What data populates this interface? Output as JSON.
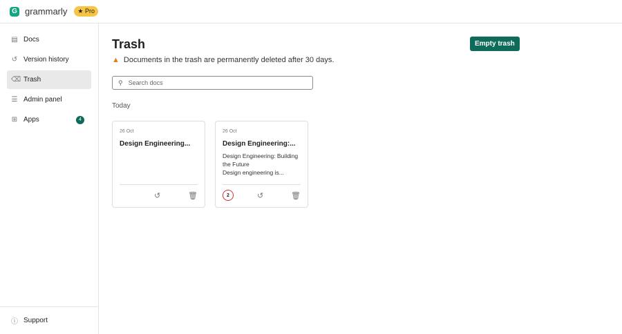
{
  "header": {
    "brand": "grammarly",
    "pro": "★ Pro"
  },
  "sidebar": {
    "items": [
      {
        "label": "Docs",
        "icon": "▤"
      },
      {
        "label": "Version history",
        "icon": "↺"
      },
      {
        "label": "Trash",
        "icon": "🗑"
      },
      {
        "label": "Admin panel",
        "icon": "☰"
      },
      {
        "label": "Apps",
        "icon": "⊞",
        "badge": "4"
      }
    ],
    "support": "Support"
  },
  "main": {
    "title": "Trash",
    "empty_label": "Empty trash",
    "warning": "Documents in the trash are permanently deleted after 30 days.",
    "search_placeholder": "Search docs",
    "section": "Today",
    "cards": [
      {
        "date": "26 Oct",
        "title": "Design Engineering...",
        "preview1": "",
        "preview2": ""
      },
      {
        "date": "26 Oct",
        "title": "Design Engineering:...",
        "preview1": "Design Engineering: Building the Future",
        "preview2": "Design engineering is...",
        "count": "2"
      }
    ]
  }
}
